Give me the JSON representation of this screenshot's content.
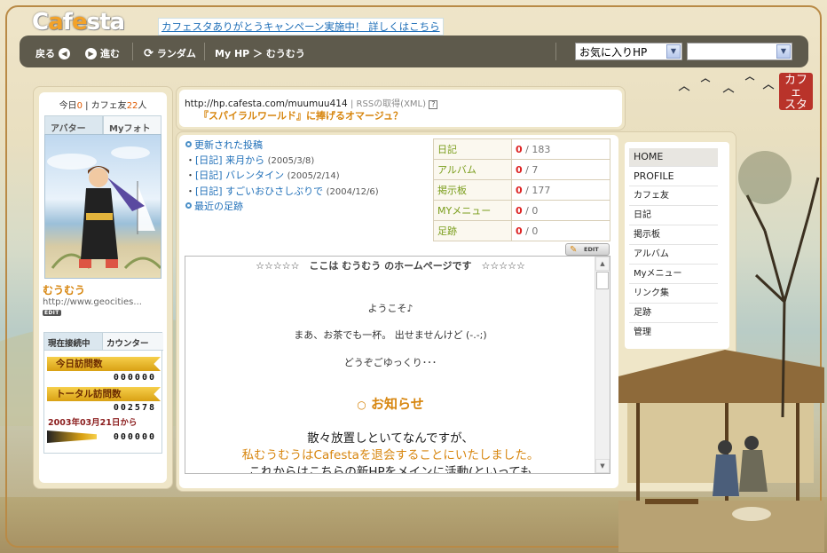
{
  "header": {
    "logo": "Cafesta",
    "campaign_link": "カフェスタありがとうキャンペーン実施中！ 詳しくはこちら",
    "stamp": "カフェスタ"
  },
  "navbar": {
    "back": "戻る",
    "forward": "進む",
    "random": "ランダム",
    "breadcrumb": "My HP ＞ むうむう",
    "favorites_select": "お気に入りHP",
    "second_select": ""
  },
  "profile": {
    "today_label": "今日",
    "today_count": "0",
    "friends_label": "| カフェ友",
    "friends_count": "22",
    "friends_suffix": "人",
    "tab_avatar": "アバター",
    "tab_photo": "Myフォト",
    "username": "むうむう",
    "homepage": "http://www.geocities...",
    "edit": "EDIT"
  },
  "counter": {
    "tab_online": "現在接続中",
    "tab_counter": "カウンター",
    "today_label": "今日訪問数",
    "today_digits": "000000",
    "total_label": "トータル訪問数",
    "total_digits": "002578",
    "since": "2003年03月21日から",
    "third_digits": "000000"
  },
  "title": {
    "url": "http://hp.cafesta.com/muumuu414",
    "rss": "| RSSの取得(XML)",
    "help": "?",
    "subtitle": "『スパイラルワールド』に捧げるオマージュ？"
  },
  "updates": {
    "header": "更新された投稿",
    "items": [
      {
        "label": "[日記] 来月から",
        "date": "(2005/3/8)"
      },
      {
        "label": "[日記] バレンタイン",
        "date": "(2005/2/14)"
      },
      {
        "label": "[日記] すごいおひさしぶりで",
        "date": "(2004/12/6)"
      }
    ],
    "footprints": "最近の足跡"
  },
  "stats": [
    {
      "label": "日記",
      "count": "0",
      "total": "/ 183"
    },
    {
      "label": "アルバム",
      "count": "0",
      "total": "/ 7"
    },
    {
      "label": "掲示板",
      "count": "0",
      "total": "/ 177"
    },
    {
      "label": "MYメニュー",
      "count": "0",
      "total": "/ 0"
    },
    {
      "label": "足跡",
      "count": "0",
      "total": "/ 0"
    }
  ],
  "edit_button": "EDIT",
  "welcome": {
    "line1": "☆☆☆☆☆　ここは むうむう のホームページです　☆☆☆☆☆",
    "line2": "ようこそ♪",
    "line3": "まあ、お茶でも一杯。 出せませんけど (-.-;)",
    "line4": "どうぞごゆっくり･･･",
    "notice_mark": "○",
    "notice": "お知らせ",
    "body1": "散々放置しといてなんですが、",
    "body2": "私むうむうはCafestaを退会することにいたしました。",
    "body3": "これからはこちらの新HPをメインに活動(といっても"
  },
  "menu": {
    "items": [
      "HOME",
      "PROFILE",
      "カフェ友",
      "日記",
      "掲示板",
      "アルバム",
      "Myメニュー",
      "リンク集",
      "足跡",
      "管理"
    ]
  },
  "colors": {
    "accent_orange": "#d7860f",
    "link_blue": "#1f6fb8",
    "navbar": "#5e5a4c",
    "label_green": "#7a9d1b",
    "count_red": "#dd2222"
  }
}
